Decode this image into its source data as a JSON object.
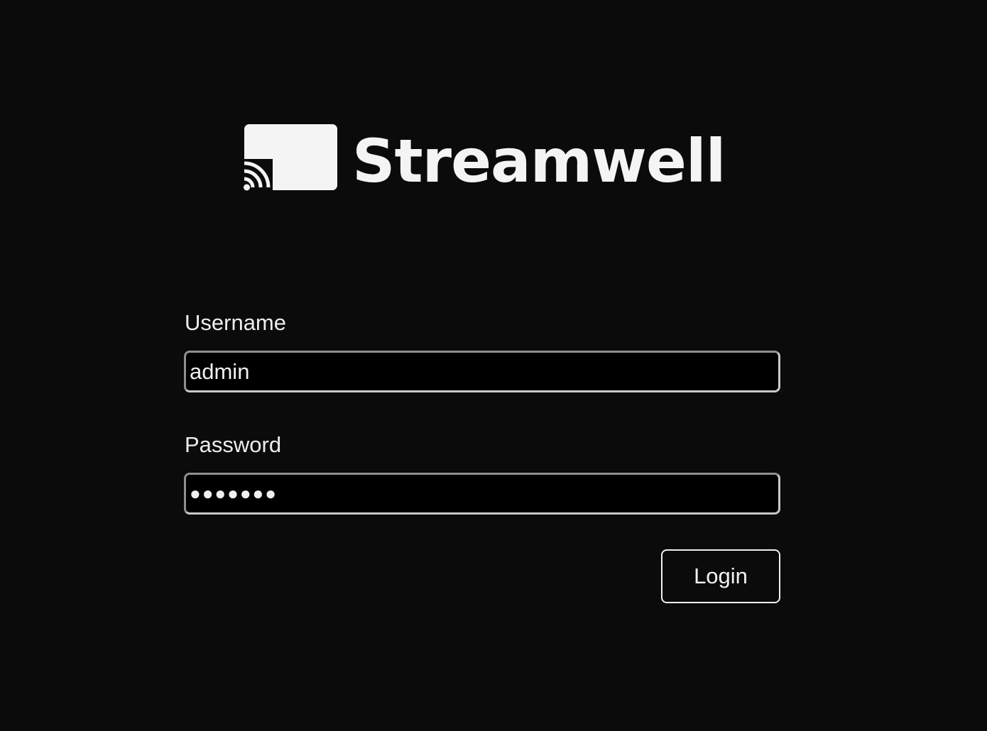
{
  "brand": {
    "name": "Streamwell",
    "logo_icon": "cast-screen-icon",
    "color": "#f4f4f4"
  },
  "form": {
    "username": {
      "label": "Username",
      "value": "admin"
    },
    "password": {
      "label": "Password",
      "value": "●●●●●●●"
    },
    "submit_label": "Login"
  },
  "colors": {
    "background": "#0b0b0b",
    "text": "#f2f2f2",
    "input_background": "#000000"
  }
}
